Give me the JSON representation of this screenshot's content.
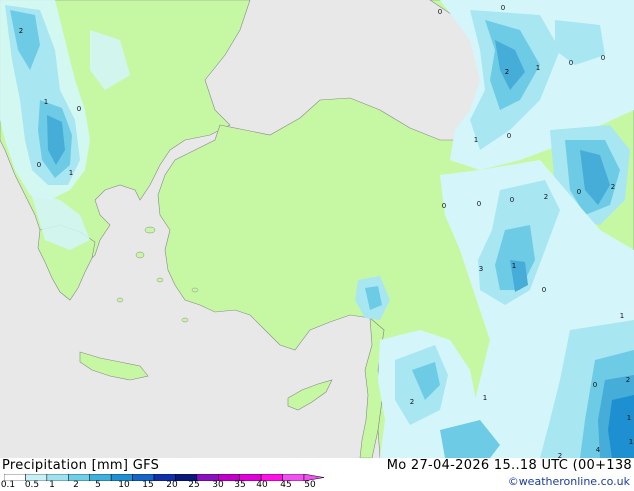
{
  "footer": {
    "title_left": "Precipitation [mm]  GFS",
    "title_right": "Mo 27-04-2026 15..18 UTC (00+138",
    "credit": "©weatheronline.co.uk"
  },
  "legend": {
    "ticks": [
      "0.1",
      "0.5",
      "1",
      "2",
      "5",
      "10",
      "15",
      "20",
      "25",
      "30",
      "35",
      "40",
      "45",
      "50"
    ],
    "colors": [
      "#ffffff",
      "#c8f0f6",
      "#9ee2f0",
      "#6dcfe8",
      "#3fb0dc",
      "#1e8fd0",
      "#1565c8",
      "#1030a8",
      "#0a1a7a",
      "#8a10c0",
      "#c000c8",
      "#e000d8",
      "#ff10e6",
      "#f050f0"
    ]
  },
  "map": {
    "land_color": "#c6f8a4",
    "sea_color": "#e8e8e8",
    "precip_light": "#d4f6fa",
    "precip_mid": "#a8e6f2",
    "precip_heavy": "#6ecbe6",
    "precip_core": "#46acd8",
    "values": [
      {
        "label": "2"
      },
      {
        "label": "1"
      },
      {
        "label": "0"
      },
      {
        "label": "0"
      },
      {
        "label": "1"
      },
      {
        "label": "0"
      },
      {
        "label": "0"
      },
      {
        "label": "2"
      },
      {
        "label": "1"
      },
      {
        "label": "0"
      },
      {
        "label": "0"
      },
      {
        "label": "1"
      },
      {
        "label": "0"
      },
      {
        "label": "0"
      },
      {
        "label": "2"
      },
      {
        "label": "0"
      },
      {
        "label": "2"
      },
      {
        "label": "0"
      },
      {
        "label": "0"
      },
      {
        "label": "0"
      },
      {
        "label": "3"
      },
      {
        "label": "1"
      },
      {
        "label": "1"
      },
      {
        "label": "2"
      },
      {
        "label": "1"
      },
      {
        "label": "0"
      },
      {
        "label": "2"
      },
      {
        "label": "2"
      },
      {
        "label": "1"
      },
      {
        "label": "4"
      },
      {
        "label": "1"
      }
    ]
  }
}
